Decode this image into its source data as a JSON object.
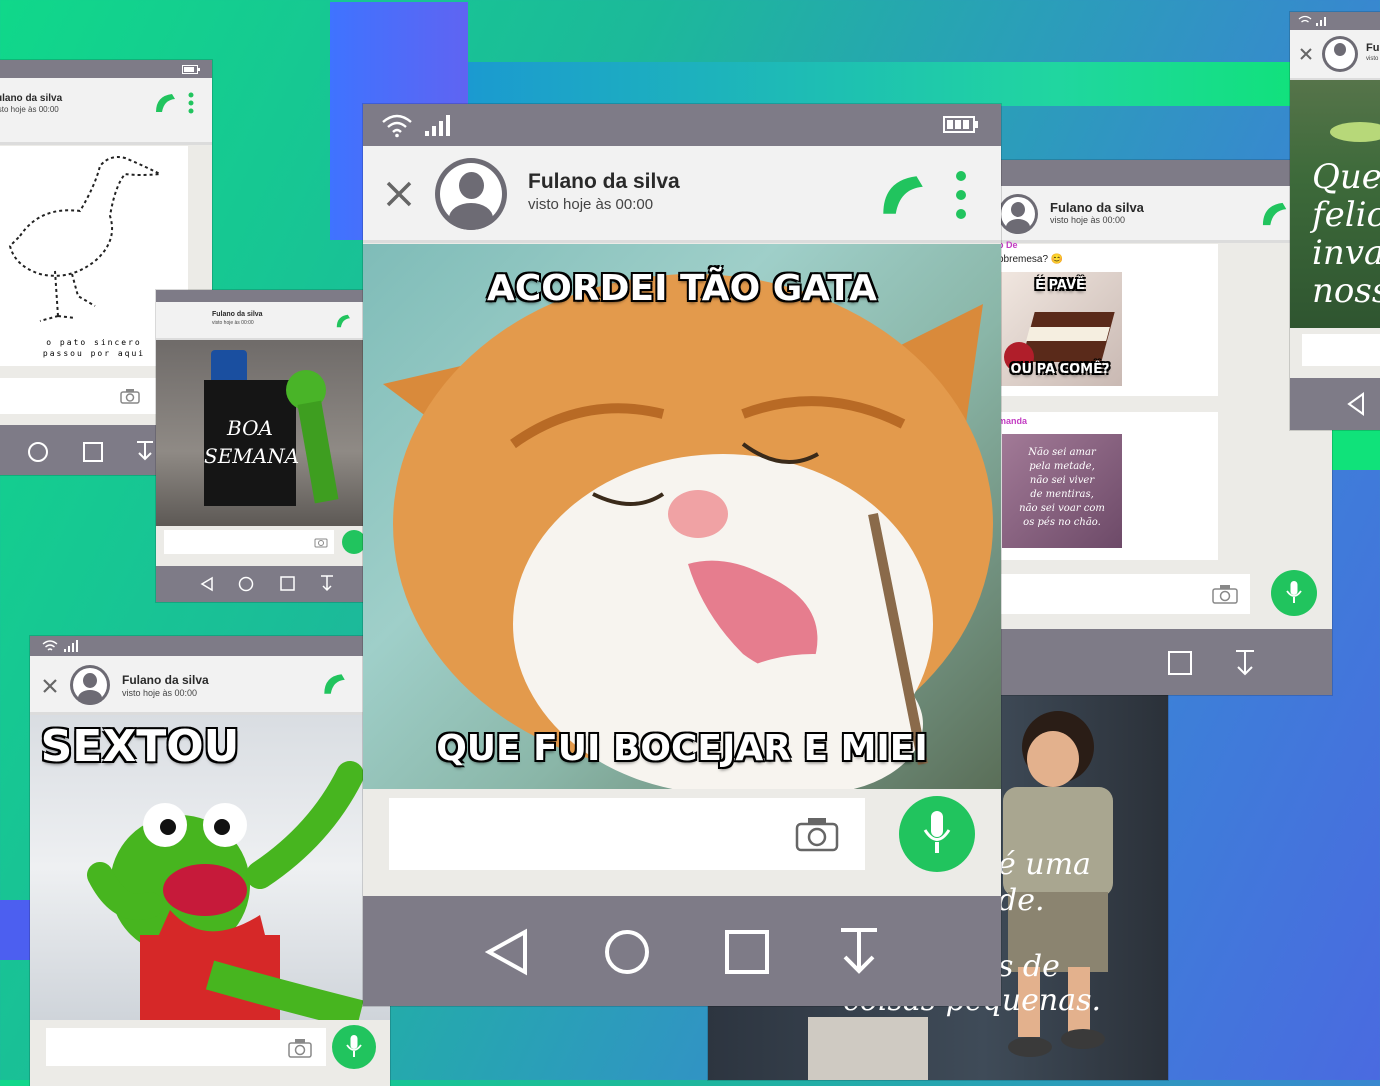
{
  "contact": {
    "name": "Fulano da silva",
    "seen": "visto hoje às 00:00"
  },
  "main": {
    "meme_top": "ACORDEI TÃO GATA",
    "meme_bottom": "QUE FUI BOCEJAR E MIEI"
  },
  "duck_card": {
    "name_partial": "ulano da silva",
    "seen_partial": "isto hoje às 00:00",
    "caption_line1": "o pato sincero",
    "caption_line2": "passou por aqui"
  },
  "kermit_small": {
    "sign_line1": "BOA",
    "sign_line2": "SEMANA"
  },
  "sextou_card": {
    "meme": "SEXTOU"
  },
  "chat_right": {
    "sender_1": "o De",
    "text_1": "obremesa? 😊",
    "img_top": "É PAVÊ",
    "img_bottom": "OU PA COMÊ?",
    "sender_2": "manda",
    "quote_lines": [
      "Não sei amar",
      "pela metade,",
      "não sei viver",
      "de mentiras,",
      "não sei voar com",
      "os pés no chão."
    ]
  },
  "boy_card": {
    "line1": "é uma",
    "line2": "de.",
    "line3": "s de",
    "line4": "coisas pequenas."
  },
  "top_right_card": {
    "name_partial": "Ful",
    "seen_partial": "visto",
    "quote_lines": [
      "Que",
      "felici",
      "invad",
      "nossa"
    ]
  },
  "colors": {
    "accent_green": "#21c45e",
    "bar_gray": "#7e7b87",
    "header_bg": "#f2f2f2"
  },
  "icons": [
    "wifi-icon",
    "signal-icon",
    "battery-icon",
    "close-icon",
    "phone-icon",
    "more-icon",
    "camera-icon",
    "mic-icon",
    "back-icon",
    "home-icon",
    "recents-icon",
    "download-icon"
  ]
}
